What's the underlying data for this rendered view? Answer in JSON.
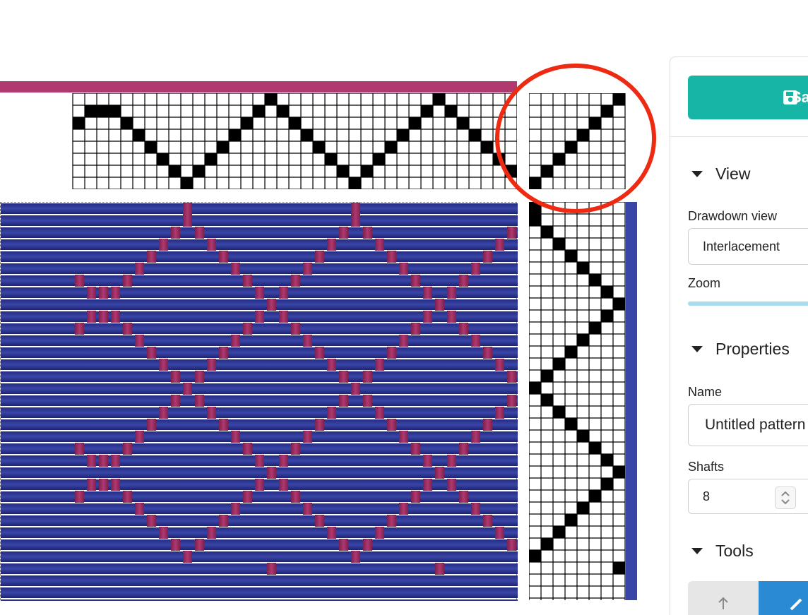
{
  "sidebar": {
    "save_label": "Save",
    "view": {
      "title": "View",
      "drawdown_label": "Drawdown view",
      "drawdown_value": "Interlacement",
      "zoom_label": "Zoom"
    },
    "properties": {
      "title": "Properties",
      "name_label": "Name",
      "name_value": "Untitled pattern",
      "shafts_label": "Shafts",
      "shafts_value": "8"
    },
    "tools": {
      "title": "Tools"
    }
  },
  "colors": {
    "warp": "#b0396e",
    "weft": "#3a45a8",
    "accent": "#16b5a6",
    "annotation": "#ee2a12",
    "tool_active": "#2a8ad4"
  },
  "threading_shafts": [
    5,
    6,
    6,
    6,
    5,
    4,
    3,
    2,
    1,
    0,
    1,
    2,
    3,
    4,
    5,
    6,
    7,
    6,
    5,
    4,
    3,
    2,
    1,
    0,
    1,
    2,
    3,
    4,
    5,
    6,
    7,
    6,
    5,
    4,
    3,
    2,
    1
  ],
  "tieup_shafts": [
    0,
    1,
    2,
    3,
    4,
    5,
    6,
    7
  ],
  "treadling_treadles": [
    0,
    0,
    1,
    2,
    3,
    4,
    5,
    6,
    7,
    6,
    5,
    4,
    3,
    2,
    1,
    0,
    1,
    2,
    3,
    4,
    5,
    6,
    7,
    6,
    5,
    4,
    3,
    2,
    1,
    0,
    7
  ]
}
